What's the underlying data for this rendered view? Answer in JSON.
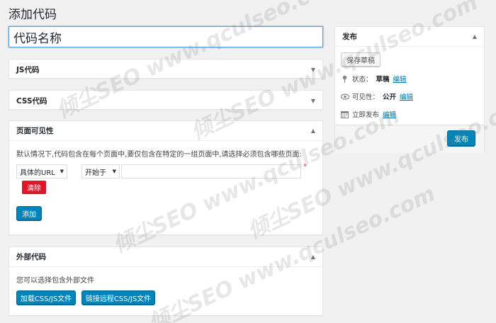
{
  "page": {
    "title": "添加代码",
    "name_input_value": "代码名称"
  },
  "boxes": {
    "js": {
      "title": "JS代码"
    },
    "css": {
      "title": "CSS代码"
    },
    "visibility": {
      "title": "页面可见性",
      "description": "默认情况下,代码包含在每个页面中,要仅包含在特定的一组页面中,请选择必须包含哪些页面:",
      "url_type": "具体的URL",
      "match_type": "开始于",
      "url_value": "",
      "required_mark": "*",
      "clear_label": "清除",
      "add_label": "添加"
    },
    "external": {
      "title": "外部代码",
      "description": "您可以选择包含外部文件",
      "load_label": "加载CSS/JS文件",
      "link_label": "链接远程CSS/JS文件"
    }
  },
  "publish": {
    "title": "发布",
    "save_draft": "保存草稿",
    "status_label": "状态：",
    "status_value": "草稿",
    "status_edit": "编辑",
    "visibility_label": "可见性：",
    "visibility_value": "公开",
    "visibility_edit": "编辑",
    "schedule_label": "立即发布",
    "schedule_edit": "编辑",
    "publish_button": "发布"
  },
  "watermark": "倾尘SEO www.qculseo.com"
}
